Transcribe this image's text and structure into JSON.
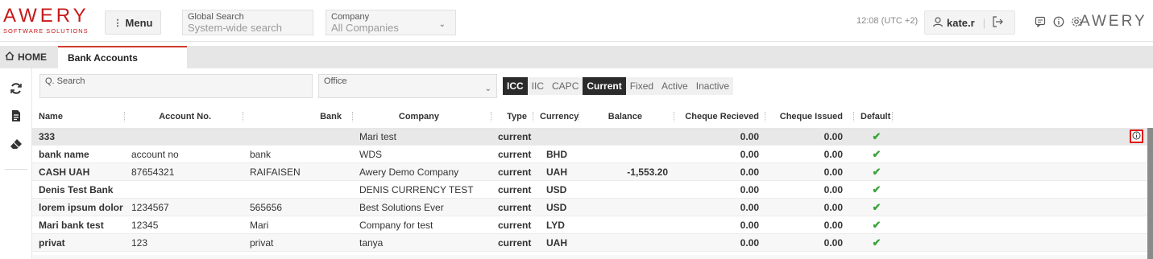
{
  "header": {
    "logo_text": "AWERY",
    "logo_sub": "SOFTWARE SOLUTIONS",
    "menu_label": "Menu",
    "global_search_label": "Global Search",
    "global_search_placeholder": "System-wide search",
    "company_label": "Company",
    "company_value": "All Companies",
    "timezone": "12:08 (UTC +2)",
    "username": "kate.r",
    "brand_right": "AWERY",
    "icons": [
      "user-icon",
      "logout-icon",
      "chat-icon",
      "info-icon",
      "settings-icon"
    ]
  },
  "tabs": {
    "home_label": "HOME",
    "active_label": "Bank Accounts"
  },
  "filters": {
    "search_label": "Q. Search",
    "office_label": "Office",
    "chips": [
      {
        "label": "ICC",
        "active": true
      },
      {
        "label": "IIC",
        "active": false
      },
      {
        "label": "CAPC",
        "active": false
      },
      {
        "label": "Current",
        "active": true
      },
      {
        "label": "Fixed",
        "active": false
      },
      {
        "label": "Active",
        "active": false
      },
      {
        "label": "Inactive",
        "active": false
      }
    ]
  },
  "table": {
    "columns": [
      "Name",
      "Account No.",
      "Bank",
      "Company",
      "Type",
      "Currency",
      "Balance",
      "Cheque Recieved",
      "Cheque Issued",
      "Default"
    ],
    "rows": [
      {
        "name": "333",
        "account": "",
        "bank": "",
        "company": "Mari test",
        "type": "current",
        "currency": "",
        "balance": "",
        "cheque_received": "0.00",
        "cheque_issued": "0.00",
        "default": "✔"
      },
      {
        "name": "bank name",
        "account": "account no",
        "bank": "bank",
        "company": "WDS",
        "type": "current",
        "currency": "BHD",
        "balance": "",
        "cheque_received": "0.00",
        "cheque_issued": "0.00",
        "default": "✔"
      },
      {
        "name": "CASH UAH",
        "account": "87654321",
        "bank": "RAIFAISEN",
        "company": "Awery Demo Company",
        "type": "current",
        "currency": "UAH",
        "balance": "-1,553.20",
        "cheque_received": "0.00",
        "cheque_issued": "0.00",
        "default": "✔"
      },
      {
        "name": "Denis Test Bank",
        "account": "",
        "bank": "",
        "company": "DENIS CURRENCY TEST",
        "type": "current",
        "currency": "USD",
        "balance": "",
        "cheque_received": "0.00",
        "cheque_issued": "0.00",
        "default": "✔"
      },
      {
        "name": "lorem ipsum dolor",
        "account": "1234567",
        "bank": "565656",
        "company": "Best Solutions Ever",
        "type": "current",
        "currency": "USD",
        "balance": "",
        "cheque_received": "0.00",
        "cheque_issued": "0.00",
        "default": "✔"
      },
      {
        "name": "Mari bank test",
        "account": "12345",
        "bank": "Mari",
        "company": "Company for test",
        "type": "current",
        "currency": "LYD",
        "balance": "",
        "cheque_received": "0.00",
        "cheque_issued": "0.00",
        "default": "✔"
      },
      {
        "name": "privat",
        "account": "123",
        "bank": "privat",
        "company": "tanya",
        "type": "current",
        "currency": "UAH",
        "balance": "",
        "cheque_received": "0.00",
        "cheque_issued": "0.00",
        "default": "✔"
      }
    ]
  },
  "colors": {
    "brand_red": "#c71919",
    "chip_active_bg": "#2b2b2b",
    "check_green": "#3ca23c",
    "highlight_red": "#e01010"
  }
}
